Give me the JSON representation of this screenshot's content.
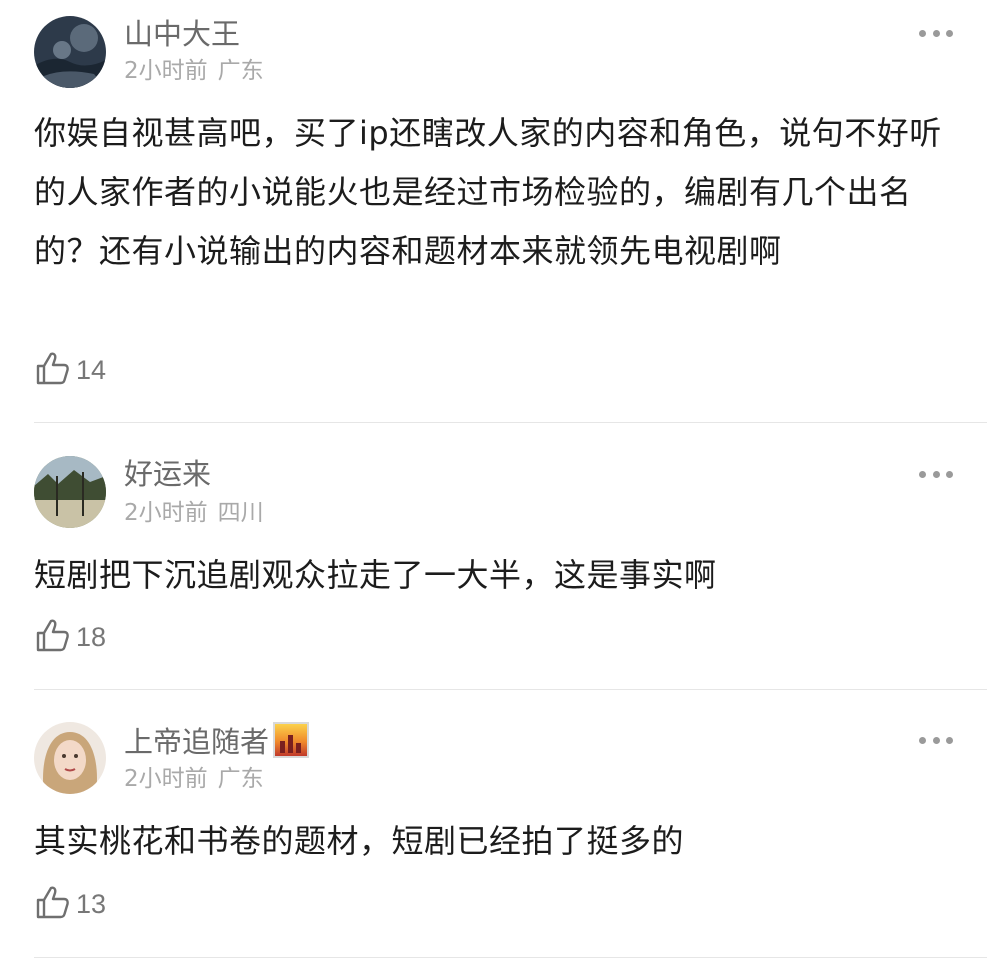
{
  "comments": [
    {
      "username": "山中大王",
      "time": "2小时前",
      "location": "广东",
      "text": "你娱自视甚高吧，买了ip还瞎改人家的内容和角色，说句不好听的人家作者的小说能火也是经过市场检验的，编剧有几个出名的？还有小说输出的内容和题材本来就领先电视剧啊",
      "likes": "14"
    },
    {
      "username": "好运来",
      "time": "2小时前",
      "location": "四川",
      "text": "短剧把下沉追剧观众拉走了一大半，这是事实啊",
      "likes": "18"
    },
    {
      "username": "上帝追随者",
      "time": "2小时前",
      "location": "广东",
      "text": "其实桃花和书卷的题材，短剧已经拍了挺多的",
      "likes": "13"
    }
  ],
  "icons": {
    "more": "more-icon",
    "like": "thumbs-up-icon",
    "badge": "member-badge-icon"
  },
  "colors": {
    "username": "#6a6a6a",
    "meta": "#a9a9a9",
    "text": "#1c1c1c",
    "divider": "#e6e6e6"
  }
}
